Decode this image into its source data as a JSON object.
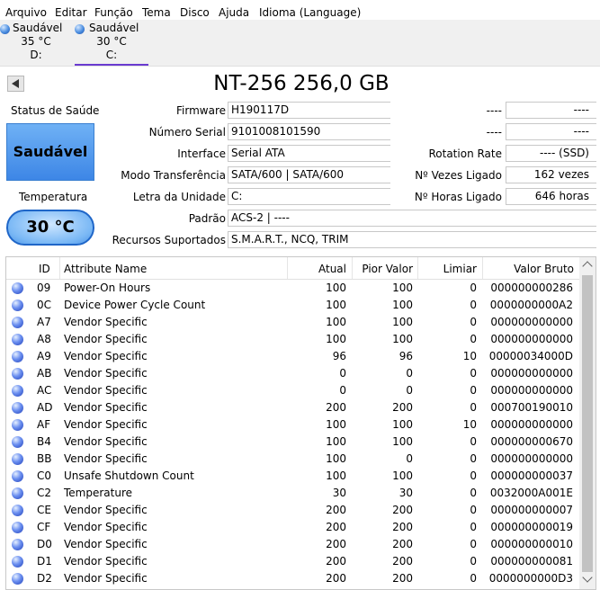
{
  "menu": [
    "Arquivo",
    "Editar",
    "Função",
    "Tema",
    "Disco",
    "Ajuda",
    "Idioma (Language)"
  ],
  "disks": [
    {
      "status": "Saudável",
      "temp": "35 °C",
      "drive": "D:"
    },
    {
      "status": "Saudável",
      "temp": "30 °C",
      "drive": "C:"
    }
  ],
  "model": "NT-256 256,0 GB",
  "health": {
    "label": "Status de Saúde",
    "value": "Saudável"
  },
  "temperature": {
    "label": "Temperatura",
    "value": "30 °C"
  },
  "info": {
    "firmware": {
      "label": "Firmware",
      "value": "H190117D"
    },
    "serial": {
      "label": "Número Serial",
      "value": "9101008101590"
    },
    "interface": {
      "label": "Interface",
      "value": "Serial ATA"
    },
    "transfer": {
      "label": "Modo Transferência",
      "value": "SATA/600 | SATA/600"
    },
    "drive_letter": {
      "label": "Letra da Unidade",
      "value": "C:"
    },
    "standard": {
      "label": "Padrão",
      "value": "ACS-2 | ----"
    },
    "features": {
      "label": "Recursos Suportados",
      "value": "S.M.A.R.T., NCQ, TRIM"
    }
  },
  "right_info": {
    "blank1": {
      "label": "----",
      "value": "----"
    },
    "blank2": {
      "label": "----",
      "value": "----"
    },
    "rotation": {
      "label": "Rotation Rate",
      "value": "---- (SSD)"
    },
    "power_count": {
      "label": "Nº Vezes Ligado",
      "value": "162 vezes"
    },
    "power_hours": {
      "label": "Nº Horas Ligado",
      "value": "646 horas"
    }
  },
  "columns": {
    "id": "ID",
    "name": "Attribute Name",
    "current": "Atual",
    "worst": "Pior Valor",
    "threshold": "Limiar",
    "raw": "Valor Bruto"
  },
  "attributes": [
    {
      "id": "09",
      "name": "Power-On Hours",
      "current": "100",
      "worst": "100",
      "threshold": "0",
      "raw": "000000000286"
    },
    {
      "id": "0C",
      "name": "Device Power Cycle Count",
      "current": "100",
      "worst": "100",
      "threshold": "0",
      "raw": "0000000000A2"
    },
    {
      "id": "A7",
      "name": "Vendor Specific",
      "current": "100",
      "worst": "100",
      "threshold": "0",
      "raw": "000000000000"
    },
    {
      "id": "A8",
      "name": "Vendor Specific",
      "current": "100",
      "worst": "100",
      "threshold": "0",
      "raw": "000000000000"
    },
    {
      "id": "A9",
      "name": "Vendor Specific",
      "current": "96",
      "worst": "96",
      "threshold": "10",
      "raw": "00000034000D"
    },
    {
      "id": "AB",
      "name": "Vendor Specific",
      "current": "0",
      "worst": "0",
      "threshold": "0",
      "raw": "000000000000"
    },
    {
      "id": "AC",
      "name": "Vendor Specific",
      "current": "0",
      "worst": "0",
      "threshold": "0",
      "raw": "000000000000"
    },
    {
      "id": "AD",
      "name": "Vendor Specific",
      "current": "200",
      "worst": "200",
      "threshold": "0",
      "raw": "000700190010"
    },
    {
      "id": "AF",
      "name": "Vendor Specific",
      "current": "100",
      "worst": "100",
      "threshold": "10",
      "raw": "000000000000"
    },
    {
      "id": "B4",
      "name": "Vendor Specific",
      "current": "100",
      "worst": "100",
      "threshold": "0",
      "raw": "000000000670"
    },
    {
      "id": "BB",
      "name": "Vendor Specific",
      "current": "100",
      "worst": "0",
      "threshold": "0",
      "raw": "000000000000"
    },
    {
      "id": "C0",
      "name": "Unsafe Shutdown Count",
      "current": "100",
      "worst": "100",
      "threshold": "0",
      "raw": "000000000037"
    },
    {
      "id": "C2",
      "name": "Temperature",
      "current": "30",
      "worst": "30",
      "threshold": "0",
      "raw": "0032000A001E"
    },
    {
      "id": "CE",
      "name": "Vendor Specific",
      "current": "200",
      "worst": "200",
      "threshold": "0",
      "raw": "000000000007"
    },
    {
      "id": "CF",
      "name": "Vendor Specific",
      "current": "200",
      "worst": "200",
      "threshold": "0",
      "raw": "000000000019"
    },
    {
      "id": "D0",
      "name": "Vendor Specific",
      "current": "200",
      "worst": "200",
      "threshold": "0",
      "raw": "000000000010"
    },
    {
      "id": "D1",
      "name": "Vendor Specific",
      "current": "200",
      "worst": "200",
      "threshold": "0",
      "raw": "000000000081"
    },
    {
      "id": "D2",
      "name": "Vendor Specific",
      "current": "200",
      "worst": "200",
      "threshold": "0",
      "raw": "0000000000D3"
    }
  ]
}
